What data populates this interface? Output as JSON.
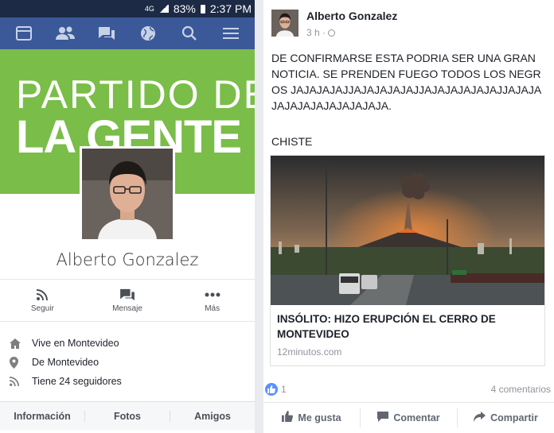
{
  "status_bar": {
    "network": "4G",
    "battery": "83%",
    "time": "2:37 PM"
  },
  "nav_icons": [
    "news-feed-icon",
    "friends-icon",
    "messages-icon",
    "globe-icon",
    "search-icon",
    "menu-icon"
  ],
  "profile": {
    "cover_line1": "PARTIDO DE",
    "cover_line2": "LA GENTE",
    "name": "Alberto Gonzalez",
    "actions": [
      {
        "label": "Seguir",
        "icon": "rss-icon"
      },
      {
        "label": "Mensaje",
        "icon": "message-icon"
      },
      {
        "label": "Más",
        "icon": "more-icon"
      }
    ],
    "info": [
      {
        "text": "Vive en Montevideo",
        "icon": "home-icon"
      },
      {
        "text": "De Montevideo",
        "icon": "location-pin-icon"
      },
      {
        "text": "Tiene 24 seguidores",
        "icon": "rss-icon"
      }
    ],
    "tabs": [
      "Información",
      "Fotos",
      "Amigos"
    ]
  },
  "post": {
    "author": "Alberto Gonzalez",
    "time": "3 h ·",
    "text": "DE CONFIRMARSE ESTA PODRIA SER UNA GRAN NOTICIA. SE PRENDEN FUEGO TODOS LOS NEGROS JAJAJAJAJJAJAJAJAJAJJAJAJAJAJAJAJJAJAJAJAJAJAJAJAJAJAJAJA.",
    "joke": "CHISTE",
    "link": {
      "title": "INSÓLITO: HIZO ERUPCIÓN EL CERRO DE MONTEVIDEO",
      "domain": "12minutos.com"
    },
    "reactions_count": "1",
    "comments": "4 comentarios",
    "actions": [
      {
        "label": "Me gusta",
        "icon": "thumbs-up-icon"
      },
      {
        "label": "Comentar",
        "icon": "comment-icon"
      },
      {
        "label": "Compartir",
        "icon": "share-icon"
      }
    ]
  },
  "colors": {
    "facebook_blue": "#3b5998",
    "status_bar": "#1c2a45",
    "cover_green": "#7abd49",
    "like_blue": "#5890ff"
  }
}
